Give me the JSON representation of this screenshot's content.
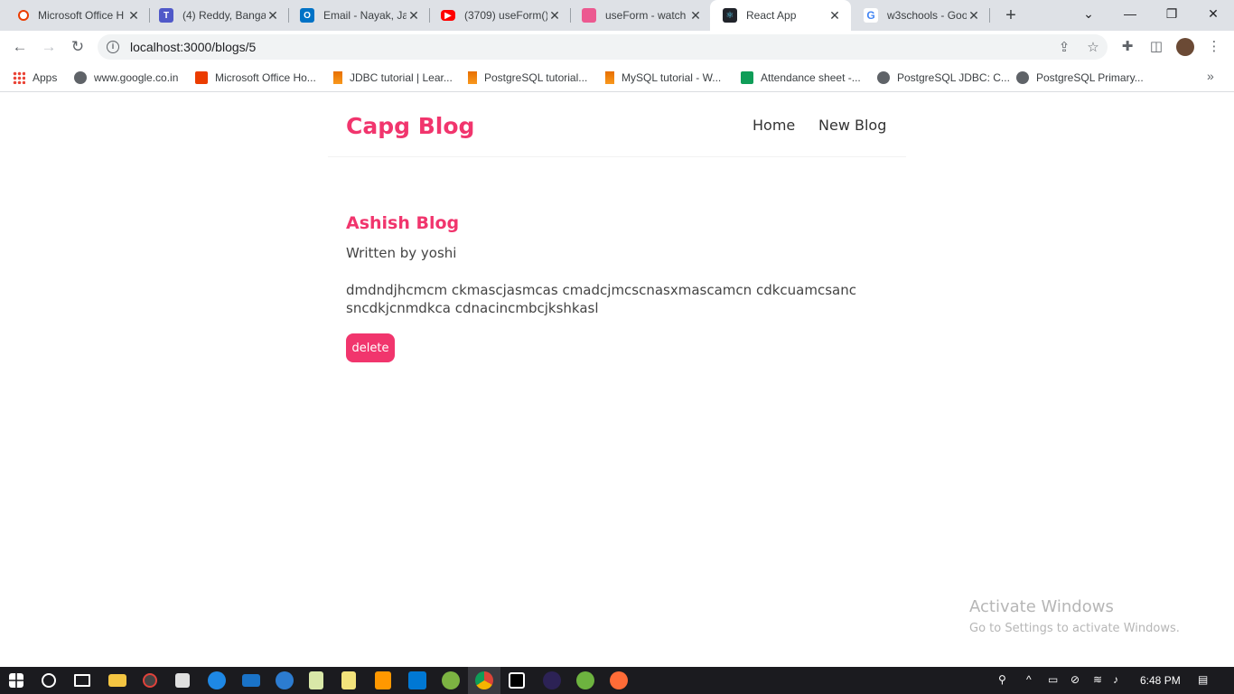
{
  "tabs": [
    {
      "title": "Microsoft Office H",
      "favicon": "office-icon",
      "color": "#eb3c00"
    },
    {
      "title": "(4) Reddy, Bangar",
      "favicon": "teams-icon",
      "color": "#5059c9"
    },
    {
      "title": "Email - Nayak, Ja",
      "favicon": "outlook-icon",
      "color": "#0072c6"
    },
    {
      "title": "(3709) useForm()",
      "favicon": "youtube-icon",
      "color": "#ff0000"
    },
    {
      "title": "useForm - watch",
      "favicon": "react-hook-form-icon",
      "color": "#ec5990"
    },
    {
      "title": "React App",
      "favicon": "react-icon",
      "color": "#20232a"
    },
    {
      "title": "w3schools - Goo",
      "favicon": "google-icon",
      "color": "#4285f4"
    }
  ],
  "address_bar": {
    "url": "localhost:3000/blogs/5"
  },
  "bookmarks": [
    {
      "label": "Apps",
      "icon": "apps-grid-icon"
    },
    {
      "label": "www.google.co.in",
      "icon": "globe-icon"
    },
    {
      "label": "Microsoft Office Ho...",
      "icon": "office-icon"
    },
    {
      "label": "JDBC tutorial | Lear...",
      "icon": "java-icon"
    },
    {
      "label": "PostgreSQL tutorial...",
      "icon": "java-icon"
    },
    {
      "label": "MySQL tutorial - W...",
      "icon": "java-icon"
    },
    {
      "label": "Attendance sheet -...",
      "icon": "sheets-icon"
    },
    {
      "label": "PostgreSQL JDBC: C...",
      "icon": "globe-icon"
    },
    {
      "label": "PostgreSQL Primary...",
      "icon": "globe-icon"
    }
  ],
  "site": {
    "brand": "Capg Blog",
    "nav": {
      "home": "Home",
      "new_blog": "New Blog"
    },
    "brand_color": "#f1356d"
  },
  "blog": {
    "title": "Ashish Blog",
    "author_line": "Written by yoshi",
    "body": "dmdndjhcmcm ckmascjasmcas cmadcjmcscnasxmascamcn cdkcuamcsanc sncdkjcnmdkca cdnacincmbcjkshkasl",
    "delete_label": "delete"
  },
  "watermark": {
    "line1": "Activate Windows",
    "line2": "Go to Settings to activate Windows."
  },
  "taskbar": {
    "time": "6:48 PM"
  }
}
